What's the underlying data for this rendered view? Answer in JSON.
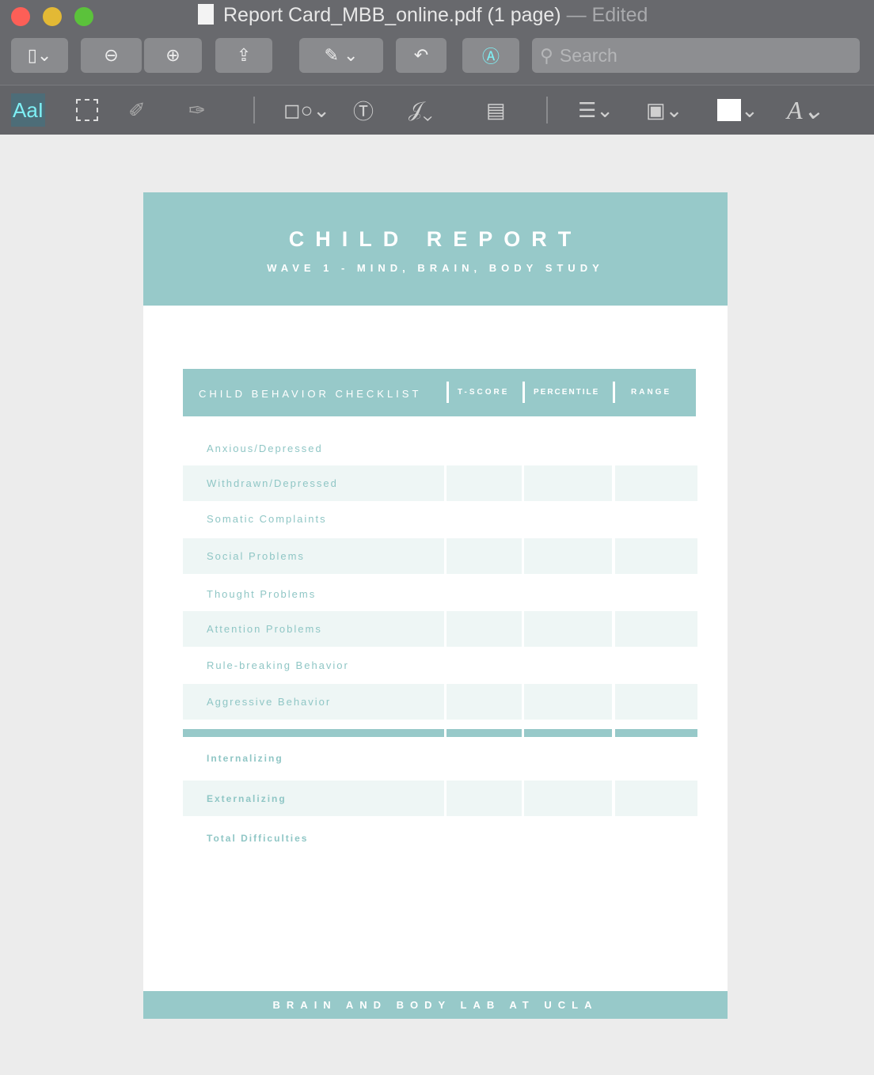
{
  "window": {
    "filename": "Report Card_MBB_online.pdf (1 page)",
    "status": "— Edited"
  },
  "toolbar": {
    "search_placeholder": "Search",
    "text_tool": "AaI"
  },
  "report": {
    "title": "CHILD REPORT",
    "subtitle": "WAVE 1 - MIND, BRAIN, BODY STUDY",
    "table_headers": [
      "CHILD BEHAVIOR CHECKLIST",
      "T-SCORE",
      "PERCENTILE",
      "RANGE"
    ],
    "rows": [
      "Anxious/Depressed",
      "Withdrawn/Depressed",
      "Somatic Complaints",
      "Social Problems",
      "Thought Problems",
      "Attention Problems",
      "Rule-breaking Behavior",
      "Aggressive Behavior"
    ],
    "summary_rows": [
      "Internalizing",
      "Externalizing",
      "Total Difficulties"
    ],
    "footer": "BRAIN AND BODY LAB AT UCLA"
  },
  "colors": {
    "teal": "#97c9c9",
    "row_shade": "#eef6f5"
  }
}
